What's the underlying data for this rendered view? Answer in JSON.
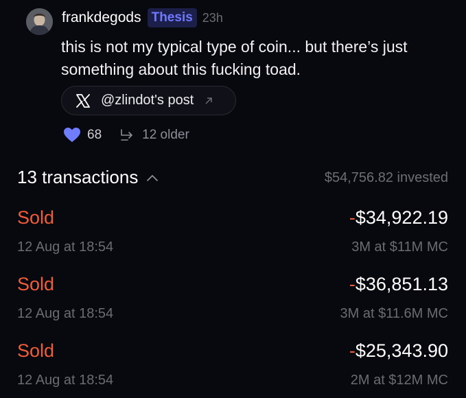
{
  "post": {
    "username": "frankdegods",
    "badge": "Thesis",
    "age": "23h",
    "text": "this is not my typical type of coin... but there’s just something about this fucking toad.",
    "source_label": "@zlindot's post",
    "likes": "68",
    "older": "12 older"
  },
  "transactions": {
    "title": "13 transactions",
    "invested": "$54,756.82 invested",
    "items": [
      {
        "type": "Sold",
        "date": "12 Aug at 18:54",
        "sign": "-",
        "amount": "$34,922.19",
        "detail": "3M at $11M MC"
      },
      {
        "type": "Sold",
        "date": "12 Aug at 18:54",
        "sign": "-",
        "amount": "$36,851.13",
        "detail": "3M at $11.6M MC"
      },
      {
        "type": "Sold",
        "date": "12 Aug at 18:54",
        "sign": "-",
        "amount": "$25,343.90",
        "detail": "2M at $12M MC"
      }
    ]
  },
  "colors": {
    "background": "#08080f",
    "sold": "#ef5d3a",
    "badge_text": "#6f79ff",
    "heart": "#6f7dff",
    "muted": "#6b6b73"
  },
  "icons": {
    "avatar": "avatar",
    "source": "x-logo-icon",
    "external": "arrow-up-right-icon",
    "like": "heart-icon",
    "older": "thread-icon",
    "collapse": "chevron-up-icon"
  }
}
